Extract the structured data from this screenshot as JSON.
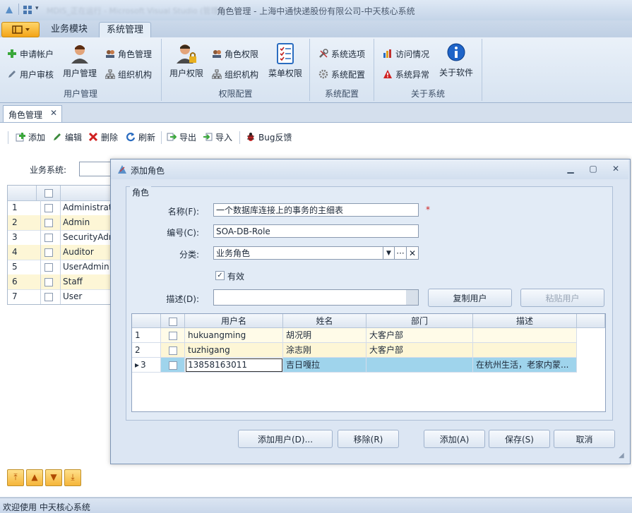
{
  "window": {
    "title": "角色管理 - 上海中通快递股份有限公司-中天核心系统",
    "blurred_tab": "MDIS_正在运行 - Microsoft Visual Studio (管理员)"
  },
  "ribbon": {
    "tabs": [
      "业务模块",
      "系统管理"
    ],
    "groups": {
      "user_mgmt": {
        "label": "用户管理",
        "apply_account": "申请帐户",
        "user_audit": "用户审核",
        "user_manage": "用户管理",
        "role_manage": "角色管理",
        "org": "组织机构"
      },
      "perm_cfg": {
        "label": "权限配置",
        "user_perm": "用户权限",
        "role_perm": "角色权限",
        "org": "组织机构",
        "menu_perm": "菜单权限"
      },
      "sys_cfg": {
        "label": "系统配置",
        "options": "系统选项",
        "config": "系统配置"
      },
      "about_sys": {
        "label": "关于系统",
        "visits": "访问情况",
        "errors": "系统异常",
        "about": "关于软件"
      }
    }
  },
  "doc_tab": {
    "label": "角色管理",
    "close": "✕"
  },
  "toolbar": {
    "add": "添加",
    "edit": "编辑",
    "delete": "删除",
    "refresh": "刷新",
    "export": "导出",
    "import": "导入",
    "bug": "Bug反馈"
  },
  "filter": {
    "label": "业务系统:"
  },
  "main_grid": {
    "rows": [
      {
        "n": "1",
        "name": "Administrator"
      },
      {
        "n": "2",
        "name": "Admin"
      },
      {
        "n": "3",
        "name": "SecurityAdmin"
      },
      {
        "n": "4",
        "name": "Auditor"
      },
      {
        "n": "5",
        "name": "UserAdmin"
      },
      {
        "n": "6",
        "name": "Staff"
      },
      {
        "n": "7",
        "name": "User"
      }
    ]
  },
  "dialog": {
    "title": "添加角色",
    "group_label": "角色",
    "name_label": "名称(F):",
    "name_value": "一个数据库连接上的事务的主细表",
    "required_mark": "*",
    "code_label": "编号(C):",
    "code_value": "SOA-DB-Role",
    "category_label": "分类:",
    "category_value": "业务角色",
    "valid_label": "有效",
    "desc_label": "描述(D):",
    "copy_users": "复制用户",
    "paste_users": "粘贴用户",
    "grid": {
      "headers": [
        "用户名",
        "姓名",
        "部门",
        "描述"
      ],
      "rows": [
        {
          "n": "1",
          "user": "hukuangming",
          "name": "胡况明",
          "dept": "大客户部",
          "desc": ""
        },
        {
          "n": "2",
          "user": "tuzhigang",
          "name": "涂志刚",
          "dept": "大客户部",
          "desc": ""
        },
        {
          "n": "3",
          "user": "13858163011",
          "name": "吉日嘎拉",
          "dept": "",
          "desc": "在杭州生活，老家内蒙..."
        }
      ]
    },
    "buttons": {
      "add_user": "添加用户(D)...",
      "remove": "移除(R)",
      "add": "添加(A)",
      "save": "保存(S)",
      "cancel": "取消"
    }
  },
  "status": {
    "text": "欢迎使用 中天核心系统"
  },
  "colors": {
    "accent": "#f3a417",
    "selected_row": "#9fd4ec",
    "alt_row": "#fdf6d6"
  }
}
